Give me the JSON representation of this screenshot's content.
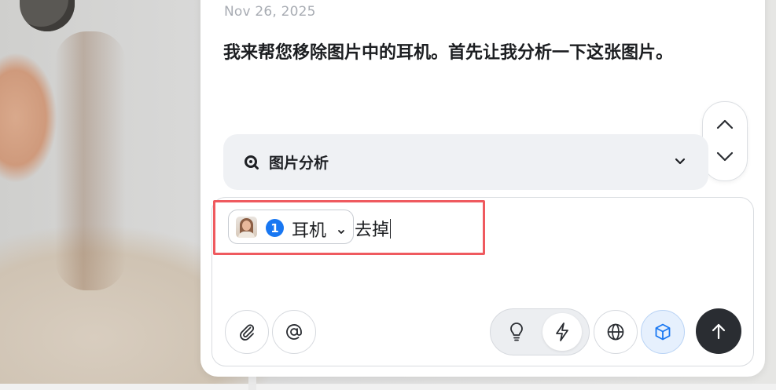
{
  "conversation": {
    "date": "Nov 26, 2025",
    "assistant_message": "我来帮您移除图片中的耳机。首先让我分析一下这张图片。"
  },
  "analysis_step": {
    "label": "图片分析",
    "icon": "search-analysis-icon",
    "expand_icon": "chevron-down-icon"
  },
  "scroll_controls": {
    "up_icon": "chevron-up-icon",
    "down_icon": "chevron-down-icon"
  },
  "composer": {
    "reference_chip": {
      "index": "1",
      "label": "耳机",
      "thumbnail": "image-thumbnail"
    },
    "input_text": "去掉",
    "buttons": {
      "attach": "paperclip-icon",
      "mention": "at-sign-icon",
      "think_mode": "lightbulb-icon",
      "fast_mode": "lightning-icon",
      "web_search": "globe-icon",
      "model": "cube-icon",
      "send": "arrow-up-icon"
    }
  },
  "colors": {
    "accent": "#1877f2",
    "highlight_border": "#ef5a5f",
    "send_button": "#2a2d32",
    "analysis_bg": "#eff1f4"
  }
}
